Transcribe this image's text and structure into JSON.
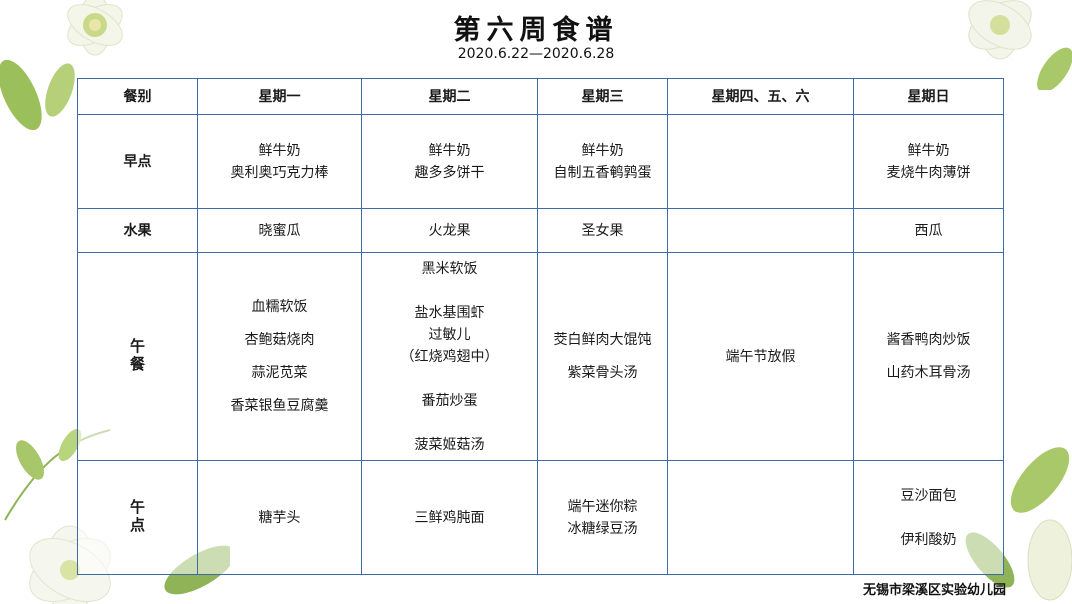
{
  "title": "第六周食谱",
  "date_range": "2020.6.22—2020.6.28",
  "table": {
    "headers": [
      "餐别",
      "星期一",
      "星期二",
      "星期三",
      "星期四、五、六",
      "星期日"
    ],
    "rows": [
      {
        "meal": "早点",
        "cells": [
          [
            "鲜牛奶",
            "奥利奥巧克力棒"
          ],
          [
            "鲜牛奶",
            "趣多多饼干"
          ],
          [
            "鲜牛奶",
            "自制五香鹌鹑蛋"
          ],
          [],
          [
            "鲜牛奶",
            "麦烧牛肉薄饼"
          ]
        ]
      },
      {
        "meal": "水果",
        "cells": [
          [
            "晓蜜瓜"
          ],
          [
            "火龙果"
          ],
          [
            "圣女果"
          ],
          [],
          [
            "西瓜"
          ]
        ]
      },
      {
        "meal": "午餐",
        "cells": [
          [
            "血糯软饭",
            "杏鲍菇烧肉",
            "蒜泥苋菜",
            "香菜银鱼豆腐羹"
          ],
          [
            "黑米软饭",
            "盐水基围虾",
            "过敏儿",
            "（红烧鸡翅中）",
            "番茄炒蛋",
            "菠菜姬菇汤"
          ],
          [
            "茭白鲜肉大馄饨",
            "紫菜骨头汤"
          ],
          [
            "端午节放假"
          ],
          [
            "酱香鸭肉炒饭",
            "山药木耳骨汤"
          ]
        ]
      },
      {
        "meal": "午点",
        "cells": [
          [
            "糖芋头"
          ],
          [
            "三鲜鸡肫面"
          ],
          [
            "端午迷你粽",
            "冰糖绿豆汤"
          ],
          [],
          [
            "豆沙面包",
            "伊利酸奶"
          ]
        ]
      }
    ]
  },
  "footer": "无锡市梁溪区实验幼儿园",
  "colors": {
    "border": "#3f6aa8",
    "leaf": "#9bbf5a",
    "petal": "#f4f6ea"
  }
}
